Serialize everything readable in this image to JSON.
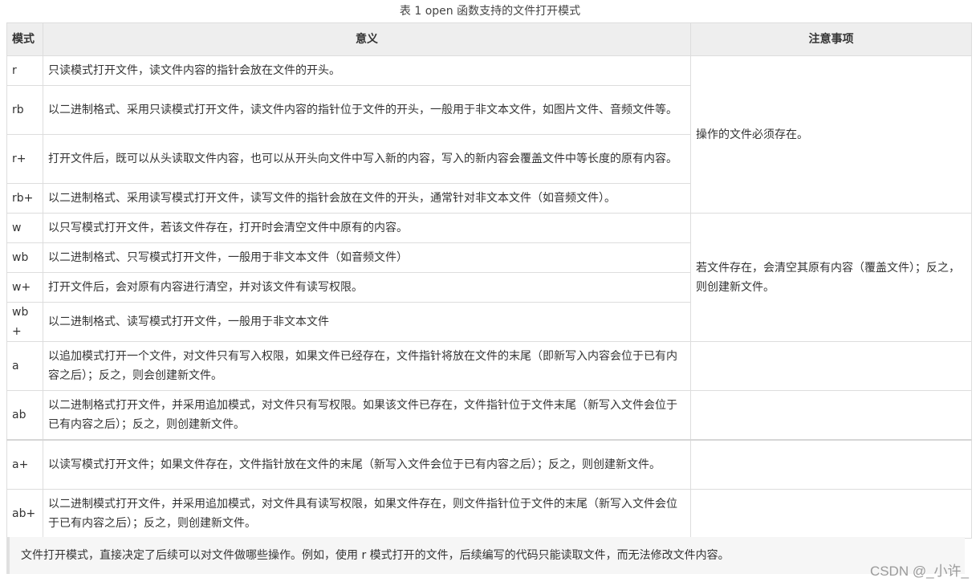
{
  "caption": "表 1 open 函数支持的文件打开模式",
  "headers": {
    "mode": "模式",
    "meaning": "意义",
    "note": "注意事项"
  },
  "rows": [
    {
      "mode": "r",
      "meaning": "只读模式打开文件，读文件内容的指针会放在文件的开头。"
    },
    {
      "mode": "rb",
      "meaning": "以二进制格式、采用只读模式打开文件，读文件内容的指针位于文件的开头，一般用于非文本文件，如图片文件、音频文件等。"
    },
    {
      "mode": "r+",
      "meaning": "打开文件后，既可以从头读取文件内容，也可以从开头向文件中写入新的内容，写入的新内容会覆盖文件中等长度的原有内容。"
    },
    {
      "mode": "rb+",
      "meaning": "以二进制格式、采用读写模式打开文件，读写文件的指针会放在文件的开头，通常针对非文本文件（如音频文件）。"
    },
    {
      "mode": "w",
      "meaning": "以只写模式打开文件，若该文件存在，打开时会清空文件中原有的内容。"
    },
    {
      "mode": "wb",
      "meaning": "以二进制格式、只写模式打开文件，一般用于非文本文件（如音频文件）"
    },
    {
      "mode": "w+",
      "meaning": "打开文件后，会对原有内容进行清空，并对该文件有读写权限。"
    },
    {
      "mode": "wb+",
      "meaning": "以二进制格式、读写模式打开文件，一般用于非文本文件"
    },
    {
      "mode": "a",
      "meaning": "以追加模式打开一个文件，对文件只有写入权限，如果文件已经存在，文件指针将放在文件的末尾（即新写入内容会位于已有内容之后）；反之，则会创建新文件。"
    },
    {
      "mode": "ab",
      "meaning": "以二进制格式打开文件，并采用追加模式，对文件只有写权限。如果该文件已存在，文件指针位于文件末尾（新写入文件会位于已有内容之后）；反之，则创建新文件。"
    },
    {
      "mode": "a+",
      "meaning": "以读写模式打开文件；如果文件存在，文件指针放在文件的末尾（新写入文件会位于已有内容之后）；反之，则创建新文件。"
    },
    {
      "mode": "ab+",
      "meaning": "以二进制模式打开文件，并采用追加模式，对文件具有读写权限，如果文件存在，则文件指针位于文件的末尾（新写入文件会位于已有内容之后）；反之，则创建新文件。"
    }
  ],
  "notes": {
    "r_group": "操作的文件必须存在。",
    "w_group": "若文件存在，会清空其原有内容（覆盖文件）；反之，则创建新文件。"
  },
  "footer_note": "文件打开模式，直接决定了后续可以对文件做哪些操作。例如，使用 r 模式打开的文件，后续编写的代码只能读取文件，而无法修改文件内容。",
  "watermark": "CSDN @_小许_"
}
